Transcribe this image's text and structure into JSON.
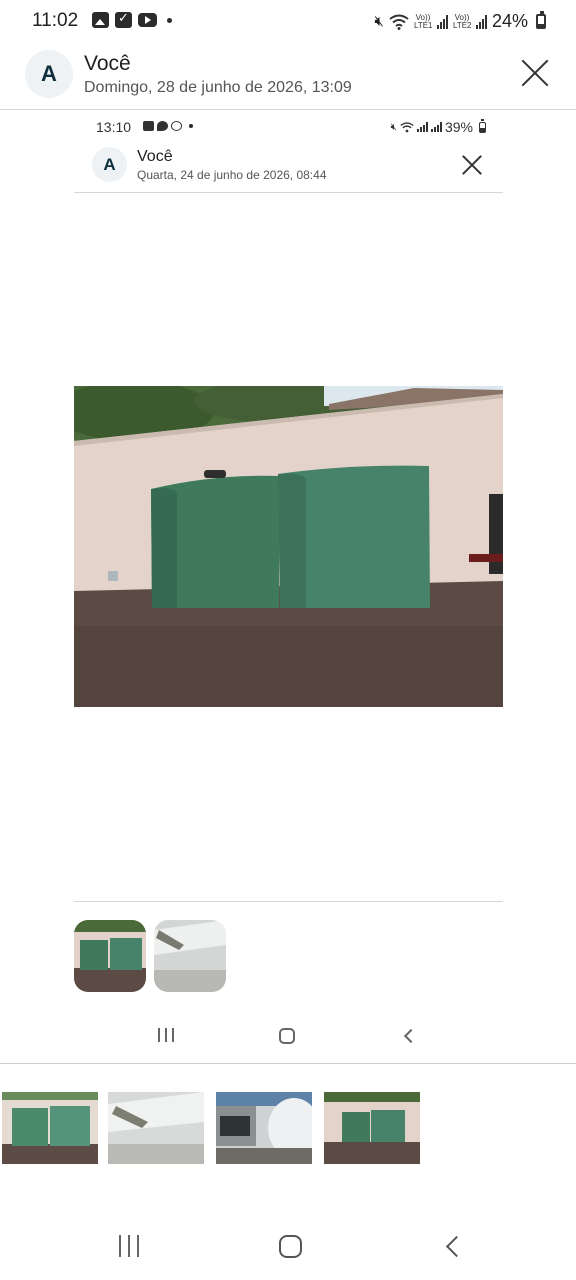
{
  "status_bar": {
    "time": "11:02",
    "notification_icons": [
      "gallery-icon",
      "check-icon",
      "youtube-icon",
      "dot-icon"
    ],
    "volte1_label": "Vo)) LTE1",
    "volte2_label": "Vo)) LTE2",
    "battery": "24%"
  },
  "header": {
    "avatar_letter": "A",
    "name": "Você",
    "date": "Domingo, 28 de junho de 2026, 13:09"
  },
  "inner_screenshot": {
    "status_bar": {
      "time": "13:10",
      "notification_icons": [
        "gallery-icon",
        "chat-icon",
        "whatsapp-icon",
        "dot-icon"
      ],
      "battery": "39%"
    },
    "header": {
      "avatar_letter": "A",
      "name": "Você",
      "date": "Quarta, 24 de junho de 2026, 08:44"
    },
    "main_photo": {
      "subject": "two green curved metal sheets leaning against a wall on gravel",
      "colors": {
        "wall": "#e4d4cb",
        "panel": "#3f7a5c",
        "ground": "#5a4a43",
        "trees": "#3a5a2e"
      }
    },
    "thumbnail_count": 2
  },
  "thumbnails": [
    {
      "name": "green panels photo"
    },
    {
      "name": "wall corner photo"
    },
    {
      "name": "truck and wall photo"
    },
    {
      "name": "green panels wide photo"
    }
  ]
}
